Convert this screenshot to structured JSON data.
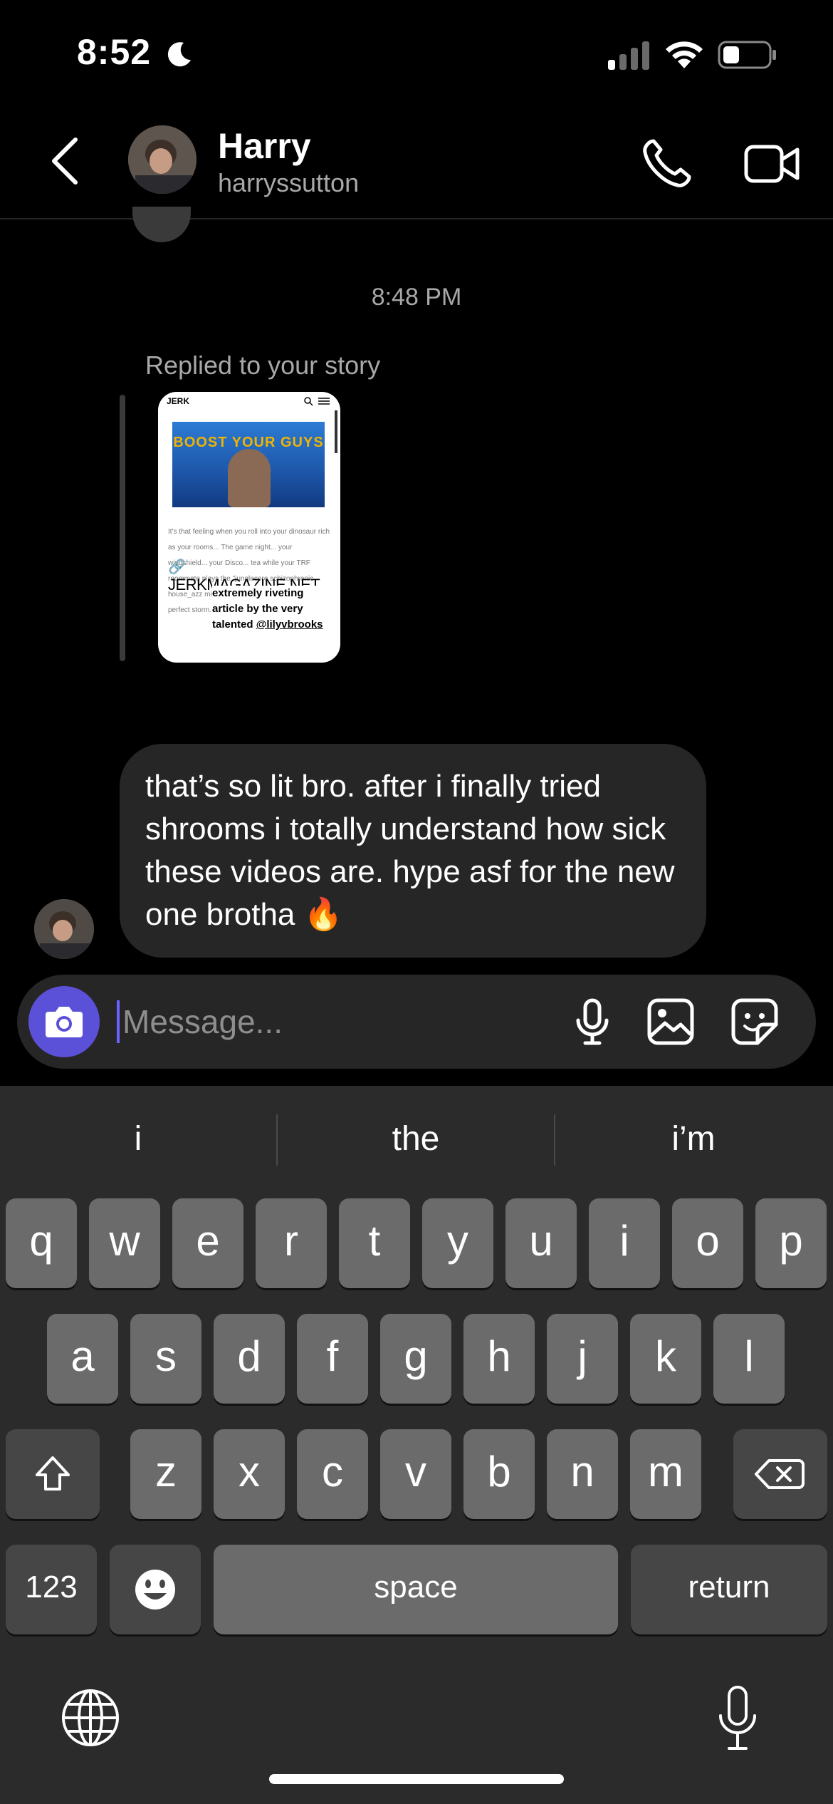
{
  "status_bar": {
    "time": "8:52",
    "icons": [
      "moon-icon",
      "signal-icon",
      "wifi-icon",
      "battery-icon"
    ]
  },
  "header": {
    "name": "Harry",
    "username": "harryssutton",
    "icons": [
      "back-chevron-icon",
      "phone-icon",
      "video-camera-icon"
    ]
  },
  "chat": {
    "timestamp": "8:48 PM",
    "replied_label": "Replied to your story",
    "story": {
      "site_logo": "JERK",
      "hero_title": "BOOST YOUR GUYS",
      "body_text": "It's that feeling when you roll into your dinosaur rich as your rooms... The game night... your windshield... your Disco... tea while your TRF roommate plays the \"junglecore schizophrenic house_azz mix\" they found on TikTok. It's the perfect storm.",
      "link_sticker": "JERKMAGAZINE.NET",
      "caption_lines": [
        "extremely riveting",
        "article by the very"
      ],
      "caption_prefix": "talented ",
      "caption_mention": "@lilyvbrooks"
    },
    "message": "that’s so lit bro. after i finally tried shrooms i totally understand how sick these videos are. hype asf for the new one brotha 🔥"
  },
  "composer": {
    "placeholder": "Message...",
    "value": "",
    "icons": [
      "camera-icon",
      "microphone-icon",
      "gallery-icon",
      "sticker-icon"
    ]
  },
  "keyboard": {
    "suggestions": [
      "i",
      "the",
      "i’m"
    ],
    "row1": [
      "q",
      "w",
      "e",
      "r",
      "t",
      "y",
      "u",
      "i",
      "o",
      "p"
    ],
    "row2": [
      "a",
      "s",
      "d",
      "f",
      "g",
      "h",
      "j",
      "k",
      "l"
    ],
    "row3": [
      "z",
      "x",
      "c",
      "v",
      "b",
      "n",
      "m"
    ],
    "numbers_label": "123",
    "space_label": "space",
    "return_label": "return",
    "icons": [
      "shift-icon",
      "delete-icon",
      "emoji-icon",
      "globe-icon",
      "dictation-mic-icon"
    ]
  },
  "colors": {
    "background": "#000000",
    "bubble": "#262626",
    "camera_accent": "#5b51d8",
    "keyboard_bg": "#2b2b2b",
    "key_light": "#6b6b6b",
    "key_dark": "#464646"
  }
}
